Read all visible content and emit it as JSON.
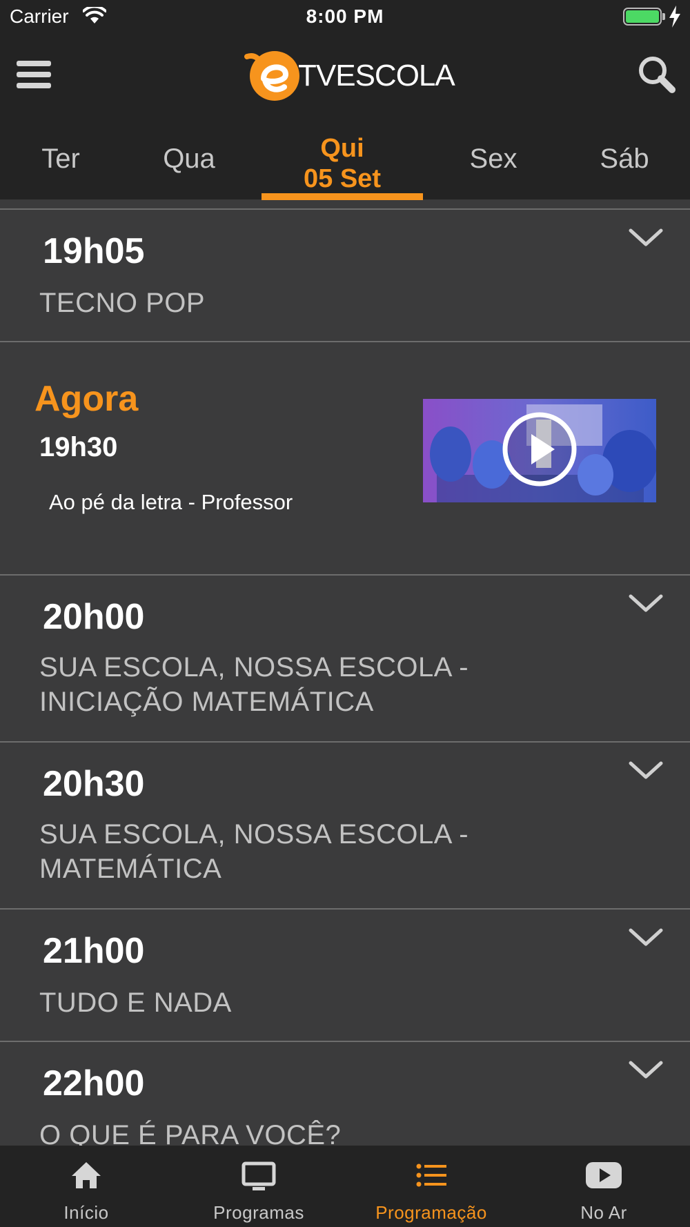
{
  "status_bar": {
    "carrier": "Carrier",
    "time": "8:00 PM"
  },
  "header": {
    "logo_text": "TVESCOLA",
    "brand_color": "#f7941d"
  },
  "day_tabs": [
    {
      "label": "Ter",
      "active": false
    },
    {
      "label": "Qua",
      "active": false
    },
    {
      "label": "Qui",
      "sublabel": "05 Set",
      "active": true
    },
    {
      "label": "Sex",
      "active": false
    },
    {
      "label": "Sáb",
      "active": false
    }
  ],
  "schedule": {
    "items": [
      {
        "time": "19h05",
        "title": "TECNO POP"
      },
      {
        "now_label": "Agora",
        "time": "19h30",
        "title": "Ao pé da letra - Professor",
        "is_now": true
      },
      {
        "time": "20h00",
        "title": "SUA ESCOLA, NOSSA ESCOLA - INICIAÇÃO MATEMÁTICA"
      },
      {
        "time": "20h30",
        "title": "SUA ESCOLA, NOSSA ESCOLA - MATEMÁTICA"
      },
      {
        "time": "21h00",
        "title": "TUDO E NADA"
      },
      {
        "time": "22h00",
        "title": "O QUE É PARA VOCÊ?"
      }
    ]
  },
  "tab_bar": {
    "items": [
      {
        "label": "Início",
        "icon": "home-icon",
        "active": false
      },
      {
        "label": "Programas",
        "icon": "tv-icon",
        "active": false
      },
      {
        "label": "Programação",
        "icon": "list-icon",
        "active": true
      },
      {
        "label": "No Ar",
        "icon": "youtube-play-icon",
        "active": false
      }
    ]
  }
}
